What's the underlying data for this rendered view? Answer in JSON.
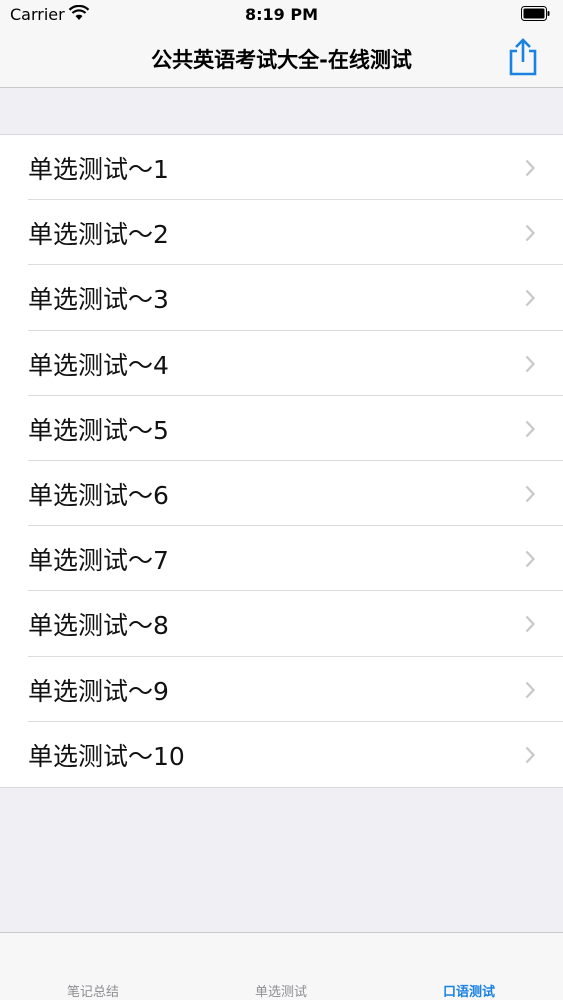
{
  "status_bar": {
    "carrier": "Carrier",
    "time": "8:19 PM"
  },
  "nav": {
    "title": "公共英语考试大全-在线测试",
    "share_icon": "share-icon"
  },
  "list": {
    "items": [
      {
        "label": "单选测试～1"
      },
      {
        "label": "单选测试～2"
      },
      {
        "label": "单选测试～3"
      },
      {
        "label": "单选测试～4"
      },
      {
        "label": "单选测试～5"
      },
      {
        "label": "单选测试～6"
      },
      {
        "label": "单选测试～7"
      },
      {
        "label": "单选测试～8"
      },
      {
        "label": "单选测试～9"
      },
      {
        "label": "单选测试～10"
      }
    ]
  },
  "tabs": [
    {
      "label": "笔记总结",
      "active": false
    },
    {
      "label": "单选测试",
      "active": false
    },
    {
      "label": "口语测试",
      "active": true
    }
  ],
  "colors": {
    "accent": "#1a82e2",
    "chevron": "#c7c7cc",
    "background": "#efeff4"
  }
}
